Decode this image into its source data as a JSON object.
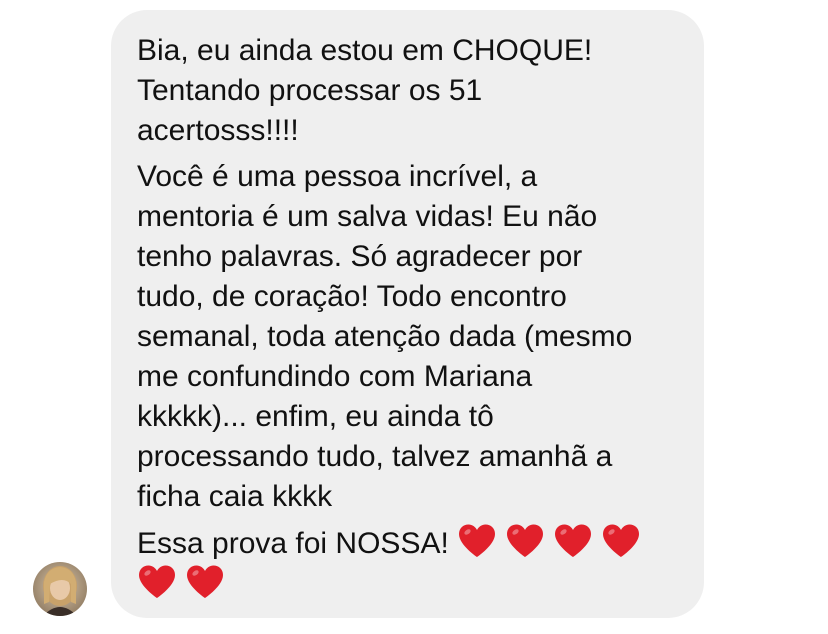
{
  "message": {
    "paragraph1": [
      "Bia, eu ainda estou em CHOQUE!",
      "Tentando processar os 51",
      "acertosss!!!!"
    ],
    "paragraph2": [
      "Você é uma pessoa incrível, a",
      "mentoria é um salva vidas! Eu não",
      "tenho palavras. Só agradecer por",
      "tudo, de coração! Todo encontro",
      "semanal, toda atenção dada (mesmo",
      "me confundindo com Mariana",
      "kkkkk)... enfim, eu ainda tô",
      "processando tudo, talvez amanhã a",
      "ficha caia kkkk"
    ],
    "paragraph3_text": "Essa prova foi NOSSA!",
    "heart_color": "#e1202b",
    "heart_icon": "red-heart-emoji",
    "hearts_line1_count": 4,
    "hearts_line2_count": 2
  },
  "colors": {
    "bubble_bg": "#efefef",
    "text": "#111111"
  }
}
